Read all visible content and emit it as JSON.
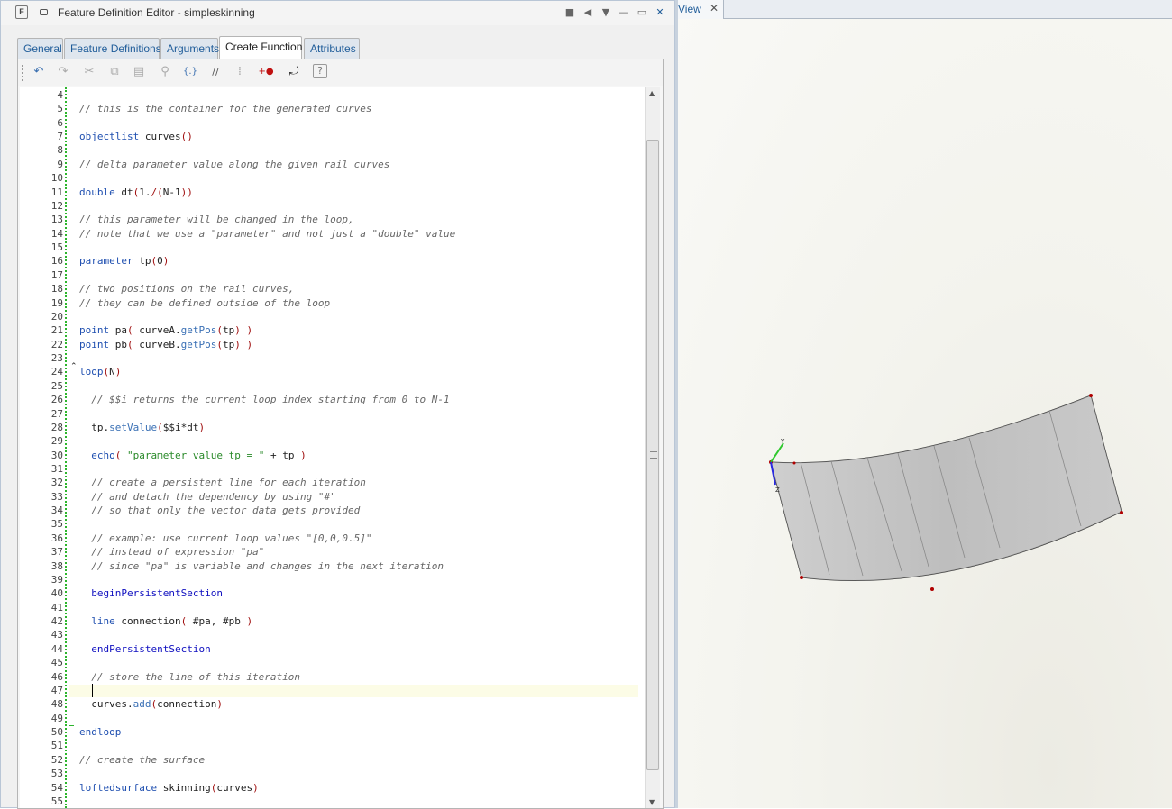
{
  "window": {
    "icon_letter": "F",
    "title": "Feature Definition Editor - simpleskinning",
    "buttons": [
      "■",
      "◀",
      "▼",
      "—",
      "▭",
      "✕"
    ]
  },
  "tabs": [
    {
      "label": "General",
      "active": false
    },
    {
      "label": "Feature Definitions",
      "active": false
    },
    {
      "label": "Arguments",
      "active": false
    },
    {
      "label": "Create Function",
      "active": true
    },
    {
      "label": "Attributes",
      "active": false
    }
  ],
  "toolbar": {
    "icons": [
      "undo-icon",
      "redo-icon",
      "cut-icon",
      "copy-icon",
      "paste-icon",
      "find-icon",
      "insert-bracket-icon",
      "comment-icon",
      "grid-icon",
      "add-item-icon",
      "run-icon",
      "help-icon"
    ],
    "glyphs": [
      "↶",
      "↷",
      "✂",
      "⧉",
      "▤",
      "⚲",
      "{.}",
      "//",
      "⁞",
      "+●",
      "⤾",
      "?"
    ]
  },
  "editor": {
    "caret_line": 47,
    "lines": [
      {
        "n": "4",
        "tokens": []
      },
      {
        "n": "5",
        "tokens": [
          {
            "c": "cm",
            "t": "// this is the container for the generated curves"
          }
        ]
      },
      {
        "n": "6",
        "tokens": []
      },
      {
        "n": "7",
        "tokens": [
          {
            "c": "kw",
            "t": "objectlist"
          },
          {
            "c": "",
            "t": " curves"
          },
          {
            "c": "pr",
            "t": "()"
          }
        ]
      },
      {
        "n": "8",
        "tokens": []
      },
      {
        "n": "9",
        "tokens": [
          {
            "c": "cm",
            "t": "// delta parameter value along the given rail curves"
          }
        ]
      },
      {
        "n": "10",
        "tokens": []
      },
      {
        "n": "11",
        "tokens": [
          {
            "c": "kw",
            "t": "double"
          },
          {
            "c": "",
            "t": " dt"
          },
          {
            "c": "pr",
            "t": "("
          },
          {
            "c": "",
            "t": "1."
          },
          {
            "c": "pr",
            "t": "/("
          },
          {
            "c": "",
            "t": "N-1"
          },
          {
            "c": "pr",
            "t": "))"
          }
        ]
      },
      {
        "n": "12",
        "tokens": []
      },
      {
        "n": "13",
        "tokens": [
          {
            "c": "cm",
            "t": "// this parameter will be changed in the loop,"
          }
        ]
      },
      {
        "n": "14",
        "tokens": [
          {
            "c": "cm",
            "t": "// note that we use a \"parameter\" and not just a \"double\" value"
          }
        ]
      },
      {
        "n": "15",
        "tokens": []
      },
      {
        "n": "16",
        "tokens": [
          {
            "c": "kw",
            "t": "parameter"
          },
          {
            "c": "",
            "t": " tp"
          },
          {
            "c": "pr",
            "t": "("
          },
          {
            "c": "",
            "t": "0"
          },
          {
            "c": "pr",
            "t": ")"
          }
        ]
      },
      {
        "n": "17",
        "tokens": []
      },
      {
        "n": "18",
        "tokens": [
          {
            "c": "cm",
            "t": "// two positions on the rail curves,"
          }
        ]
      },
      {
        "n": "19",
        "tokens": [
          {
            "c": "cm",
            "t": "// they can be defined outside of the loop"
          }
        ]
      },
      {
        "n": "20",
        "tokens": []
      },
      {
        "n": "21",
        "tokens": [
          {
            "c": "kw",
            "t": "point"
          },
          {
            "c": "",
            "t": " pa"
          },
          {
            "c": "pr",
            "t": "("
          },
          {
            "c": "",
            "t": " curveA."
          },
          {
            "c": "fn",
            "t": "getPos"
          },
          {
            "c": "pr",
            "t": "("
          },
          {
            "c": "",
            "t": "tp"
          },
          {
            "c": "pr",
            "t": ")"
          },
          {
            "c": "",
            "t": " "
          },
          {
            "c": "pr",
            "t": ")"
          }
        ]
      },
      {
        "n": "22",
        "tokens": [
          {
            "c": "kw",
            "t": "point"
          },
          {
            "c": "",
            "t": " pb"
          },
          {
            "c": "pr",
            "t": "("
          },
          {
            "c": "",
            "t": " curveB."
          },
          {
            "c": "fn",
            "t": "getPos"
          },
          {
            "c": "pr",
            "t": "("
          },
          {
            "c": "",
            "t": "tp"
          },
          {
            "c": "pr",
            "t": ")"
          },
          {
            "c": "",
            "t": " "
          },
          {
            "c": "pr",
            "t": ")"
          }
        ]
      },
      {
        "n": "23",
        "tokens": []
      },
      {
        "n": "24",
        "tokens": [
          {
            "c": "kw",
            "t": "loop"
          },
          {
            "c": "pr",
            "t": "("
          },
          {
            "c": "",
            "t": "N"
          },
          {
            "c": "pr",
            "t": ")"
          }
        ]
      },
      {
        "n": "25",
        "tokens": []
      },
      {
        "n": "26",
        "tokens": [
          {
            "c": "cm",
            "t": "  // $$i returns the current loop index starting from 0 to N-1"
          }
        ]
      },
      {
        "n": "27",
        "tokens": []
      },
      {
        "n": "28",
        "tokens": [
          {
            "c": "",
            "t": "  tp."
          },
          {
            "c": "fn",
            "t": "setValue"
          },
          {
            "c": "pr",
            "t": "("
          },
          {
            "c": "",
            "t": "$$i*dt"
          },
          {
            "c": "pr",
            "t": ")"
          }
        ]
      },
      {
        "n": "29",
        "tokens": []
      },
      {
        "n": "30",
        "tokens": [
          {
            "c": "",
            "t": "  "
          },
          {
            "c": "kw",
            "t": "echo"
          },
          {
            "c": "pr",
            "t": "("
          },
          {
            "c": "",
            "t": " "
          },
          {
            "c": "st",
            "t": "\"parameter value tp = \""
          },
          {
            "c": "",
            "t": " + tp "
          },
          {
            "c": "pr",
            "t": ")"
          }
        ]
      },
      {
        "n": "31",
        "tokens": []
      },
      {
        "n": "32",
        "tokens": [
          {
            "c": "cm",
            "t": "  // create a persistent line for each iteration"
          }
        ]
      },
      {
        "n": "33",
        "tokens": [
          {
            "c": "cm",
            "t": "  // and detach the dependency by using \"#\""
          }
        ]
      },
      {
        "n": "34",
        "tokens": [
          {
            "c": "cm",
            "t": "  // so that only the vector data gets provided"
          }
        ]
      },
      {
        "n": "35",
        "tokens": []
      },
      {
        "n": "36",
        "tokens": [
          {
            "c": "cm",
            "t": "  // example: use current loop values \"[0,0,0.5]\""
          }
        ]
      },
      {
        "n": "37",
        "tokens": [
          {
            "c": "cm",
            "t": "  // instead of expression \"pa\""
          }
        ]
      },
      {
        "n": "38",
        "tokens": [
          {
            "c": "cm",
            "t": "  // since \"pa\" is variable and changes in the next iteration"
          }
        ]
      },
      {
        "n": "39",
        "tokens": []
      },
      {
        "n": "40",
        "tokens": [
          {
            "c": "",
            "t": "  "
          },
          {
            "c": "bl",
            "t": "beginPersistentSection"
          }
        ]
      },
      {
        "n": "41",
        "tokens": []
      },
      {
        "n": "42",
        "tokens": [
          {
            "c": "",
            "t": "  "
          },
          {
            "c": "kw",
            "t": "line"
          },
          {
            "c": "",
            "t": " connection"
          },
          {
            "c": "pr",
            "t": "("
          },
          {
            "c": "",
            "t": " #pa, #pb "
          },
          {
            "c": "pr",
            "t": ")"
          }
        ]
      },
      {
        "n": "43",
        "tokens": []
      },
      {
        "n": "44",
        "tokens": [
          {
            "c": "",
            "t": "  "
          },
          {
            "c": "bl",
            "t": "endPersistentSection"
          }
        ]
      },
      {
        "n": "45",
        "tokens": []
      },
      {
        "n": "46",
        "tokens": [
          {
            "c": "cm",
            "t": "  // store the line of this iteration"
          }
        ]
      },
      {
        "n": "47",
        "tokens": []
      },
      {
        "n": "48",
        "tokens": [
          {
            "c": "",
            "t": "  curves."
          },
          {
            "c": "fn",
            "t": "add"
          },
          {
            "c": "pr",
            "t": "("
          },
          {
            "c": "",
            "t": "connection"
          },
          {
            "c": "pr",
            "t": ")"
          }
        ]
      },
      {
        "n": "49",
        "tokens": []
      },
      {
        "n": "50",
        "tokens": [
          {
            "c": "kw",
            "t": "endloop"
          }
        ]
      },
      {
        "n": "51",
        "tokens": []
      },
      {
        "n": "52",
        "tokens": [
          {
            "c": "cm",
            "t": "// create the surface"
          }
        ]
      },
      {
        "n": "53",
        "tokens": []
      },
      {
        "n": "54",
        "tokens": [
          {
            "c": "kw",
            "t": "loftedsurface"
          },
          {
            "c": "",
            "t": " skinning"
          },
          {
            "c": "pr",
            "t": "("
          },
          {
            "c": "",
            "t": "curves"
          },
          {
            "c": "pr",
            "t": ")"
          }
        ]
      },
      {
        "n": "55",
        "tokens": []
      }
    ]
  },
  "view": {
    "tab_label": "View",
    "close_glyph": "✕",
    "axis_labels": {
      "y": "Y",
      "z": "Z"
    },
    "colors": {
      "surface": "#c4c4c4",
      "edge": "#333333",
      "control_point": "#b00000",
      "axis_y": "#2ec82e",
      "axis_z": "#2a2ae0"
    }
  }
}
